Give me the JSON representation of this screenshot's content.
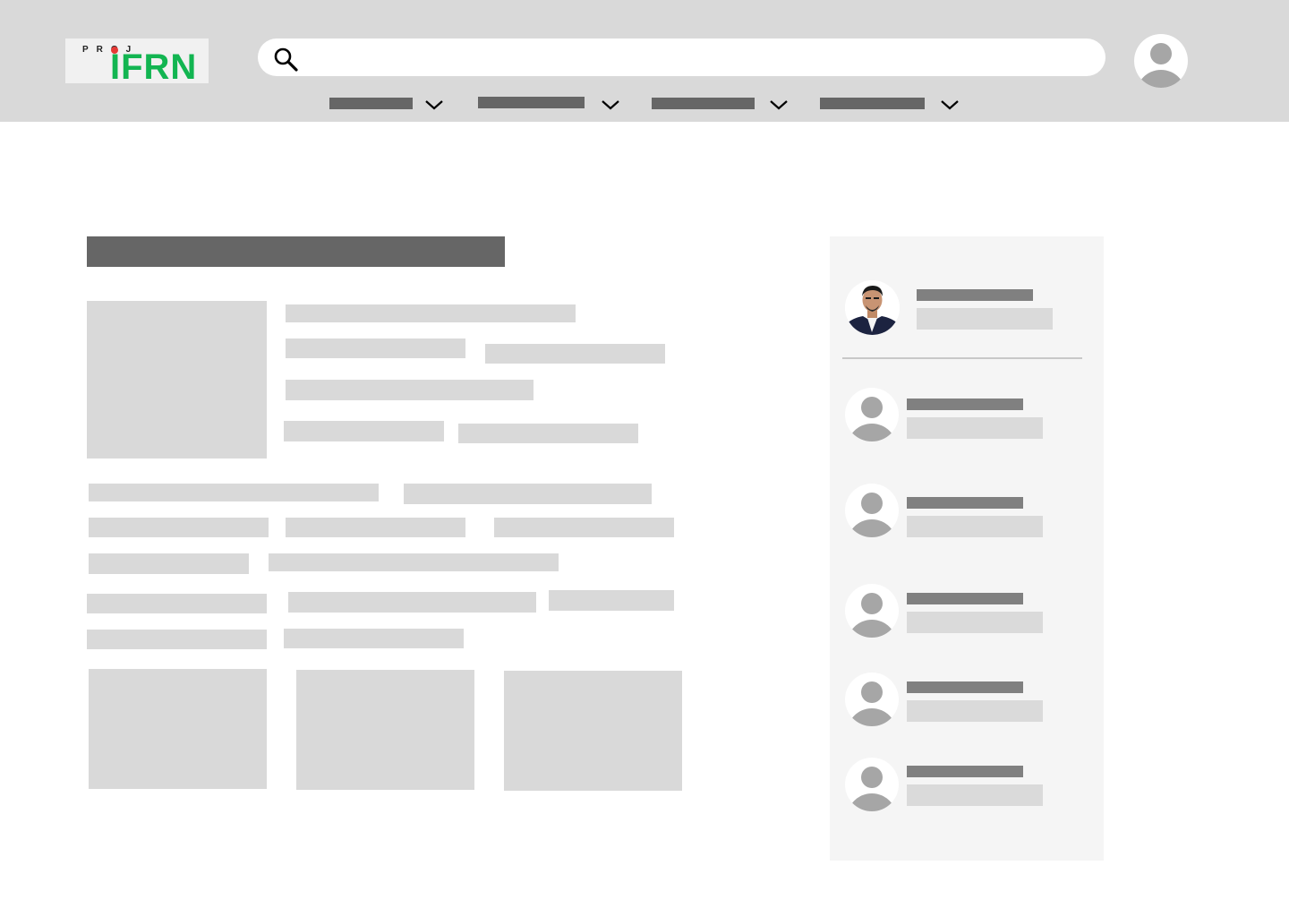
{
  "brand": {
    "logo_lettering": "PROJ IFRN",
    "logo_colors": {
      "background": "#f1f1f1",
      "wordmark": "#12b551",
      "dot": "#e53935"
    }
  },
  "header": {
    "search": {
      "placeholder": "",
      "value": "",
      "icon": "search-icon"
    },
    "account": {
      "icon": "user-avatar-icon"
    },
    "nav": [
      {
        "label": "",
        "icon": "chevron-down-icon"
      },
      {
        "label": "",
        "icon": "chevron-down-icon"
      },
      {
        "label": "",
        "icon": "chevron-down-icon"
      },
      {
        "label": "",
        "icon": "chevron-down-icon"
      }
    ]
  },
  "colors": {
    "header_bg": "#d9d9d9",
    "placeholder_dark": "#666666",
    "placeholder_light": "#d9d9d9",
    "sidebar_bg": "#f5f5f5",
    "avatar_gray": "#a6a6a6"
  },
  "sidebar": {
    "featured_user": {
      "image": "profile-photo"
    },
    "users": [
      {
        "icon": "user-avatar-icon"
      },
      {
        "icon": "user-avatar-icon"
      },
      {
        "icon": "user-avatar-icon"
      },
      {
        "icon": "user-avatar-icon"
      },
      {
        "icon": "user-avatar-icon"
      }
    ]
  }
}
